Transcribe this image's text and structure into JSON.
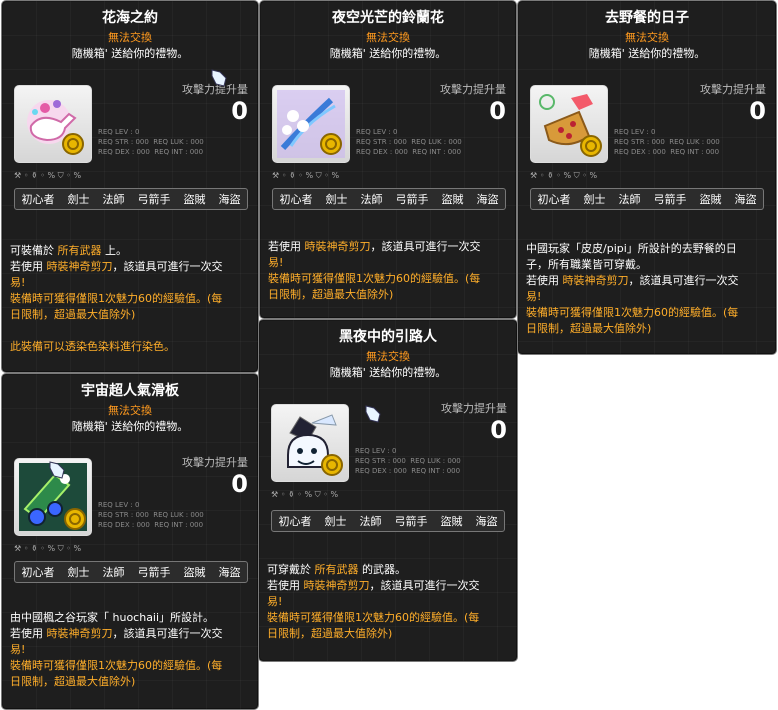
{
  "common": {
    "untradable": "無法交換",
    "source": "隨機箱' 送給你的禮物。",
    "atk_label": "攻擊力提升量",
    "atk_value": "0",
    "req_lev": "REQ LEV :",
    "req_lev_val": "0",
    "req_str": "REQ STR :",
    "req_str_val": "000",
    "req_dex": "REQ DEX :",
    "req_dex_val": "000",
    "req_luk": "REQ LUK :",
    "req_luk_val": "000",
    "req_int": "REQ INT :",
    "req_int_val": "000",
    "percent": "%",
    "jobs": [
      "初心者",
      "劍士",
      "法師",
      "弓箭手",
      "盜賊",
      "海盜"
    ]
  },
  "tooltips": [
    {
      "title": "花海之約",
      "desc": [
        {
          "parts": [
            {
              "t": "可裝備於 "
            },
            {
              "t": "所有武器",
              "c": "hl"
            },
            {
              "t": " 上。"
            }
          ]
        },
        {
          "parts": [
            {
              "t": "若使用 "
            },
            {
              "t": "時裝神奇剪刀",
              "c": "hl"
            },
            {
              "t": "，該道具可進行一次交"
            }
          ]
        },
        {
          "parts": [
            {
              "t": "易!",
              "c": "hl"
            }
          ]
        },
        {
          "parts": [
            {
              "t": " 裝備時可獲得僅限1次魅力60的經驗值。(每",
              "c": "or"
            }
          ]
        },
        {
          "parts": [
            {
              "t": "日限制，超過最大值除外)",
              "c": "or"
            }
          ]
        },
        {
          "parts": [
            {
              "t": ""
            }
          ]
        },
        {
          "parts": [
            {
              "t": " 此裝備可以透染色染料進行染色。",
              "c": "or"
            }
          ]
        }
      ]
    },
    {
      "title": "夜空光芒的鈴蘭花",
      "desc": [
        {
          "parts": [
            {
              "t": "若使用 "
            },
            {
              "t": "時裝神奇剪刀",
              "c": "hl"
            },
            {
              "t": "，該道具可進行一次交"
            }
          ]
        },
        {
          "parts": [
            {
              "t": "易!",
              "c": "hl"
            }
          ]
        },
        {
          "parts": [
            {
              "t": " 裝備時可獲得僅限1次魅力60的經驗值。(每",
              "c": "or"
            }
          ]
        },
        {
          "parts": [
            {
              "t": "日限制，超過最大值除外)",
              "c": "or"
            }
          ]
        }
      ]
    },
    {
      "title": "去野餐的日子",
      "desc": [
        {
          "parts": [
            {
              "t": "中國玩家「皮皮/pipi」所設計的去野餐的日"
            }
          ]
        },
        {
          "parts": [
            {
              "t": "子，所有職業皆可穿戴。"
            }
          ]
        },
        {
          "parts": [
            {
              "t": "若使用 "
            },
            {
              "t": "時裝神奇剪刀",
              "c": "hl"
            },
            {
              "t": "，該道具可進行一次交"
            }
          ]
        },
        {
          "parts": [
            {
              "t": "易!",
              "c": "hl"
            }
          ]
        },
        {
          "parts": [
            {
              "t": " 裝備時可獲得僅限1次魅力60的經驗值。(每",
              "c": "or"
            }
          ]
        },
        {
          "parts": [
            {
              "t": "日限制，超過最大值除外)",
              "c": "or"
            }
          ]
        }
      ]
    },
    {
      "title": "宇宙超人氣滑板",
      "desc": [
        {
          "parts": [
            {
              "t": "由中國楓之谷玩家「 huochaii」所設計。"
            }
          ]
        },
        {
          "parts": [
            {
              "t": "若使用 "
            },
            {
              "t": "時裝神奇剪刀",
              "c": "hl"
            },
            {
              "t": "，該道具可進行一次交"
            }
          ]
        },
        {
          "parts": [
            {
              "t": "易!",
              "c": "hl"
            }
          ]
        },
        {
          "parts": [
            {
              "t": " 裝備時可獲得僅限1次魅力60的經驗值。(每",
              "c": "or"
            }
          ]
        },
        {
          "parts": [
            {
              "t": "日限制，超過最大值除外)",
              "c": "or"
            }
          ]
        }
      ]
    },
    {
      "title": "黑夜中的引路人",
      "desc": [
        {
          "parts": [
            {
              "t": "可穿戴於 "
            },
            {
              "t": "所有武器",
              "c": "hl"
            },
            {
              "t": " 的武器。"
            }
          ]
        },
        {
          "parts": [
            {
              "t": "若使用 "
            },
            {
              "t": "時裝神奇剪刀",
              "c": "hl"
            },
            {
              "t": "，該道具可進行一次交"
            }
          ]
        },
        {
          "parts": [
            {
              "t": "易!",
              "c": "hl"
            }
          ]
        },
        {
          "parts": [
            {
              "t": " 裝備時可獲得僅限1次魅力60的經驗值。(每",
              "c": "or"
            }
          ]
        },
        {
          "parts": [
            {
              "t": "日限制，超過最大值除外)",
              "c": "or"
            }
          ]
        }
      ]
    }
  ]
}
